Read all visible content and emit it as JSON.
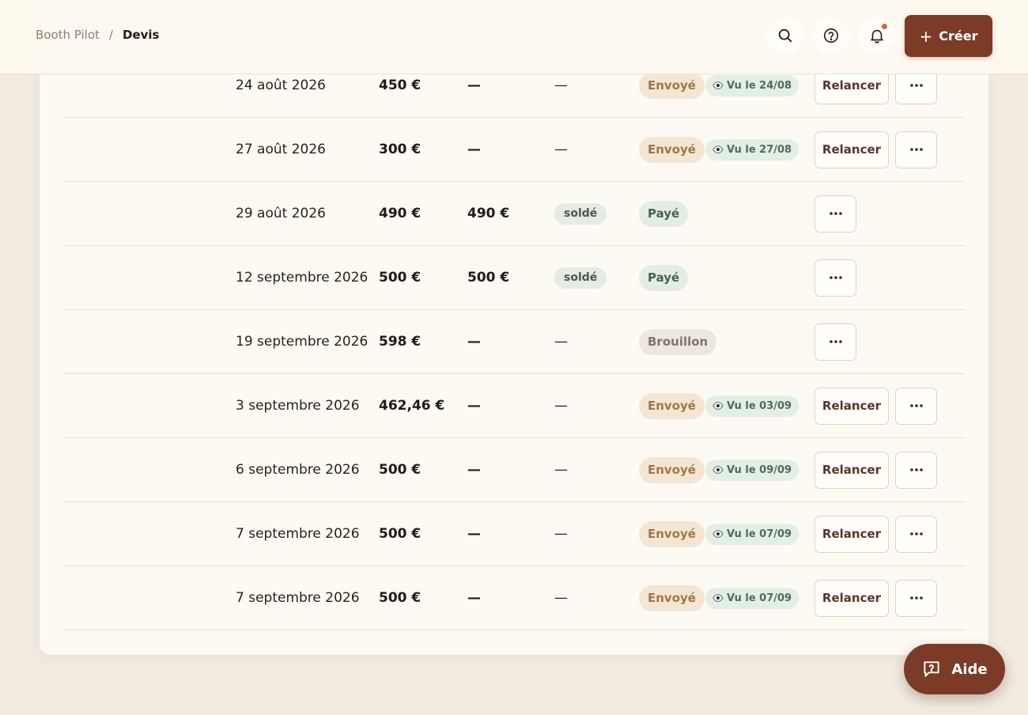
{
  "header": {
    "breadcrumb_parent": "Booth Pilot",
    "breadcrumb_separator": "/",
    "breadcrumb_current": "Devis",
    "create_label": "Créer",
    "create_icon": "plus-icon",
    "icons": [
      "search-icon",
      "help-icon",
      "bell-icon"
    ]
  },
  "help_button": {
    "label": "Aide",
    "icon": "chat-icon"
  },
  "rows": [
    {
      "date": "24 août 2026",
      "amount": "450 €",
      "paid": "—",
      "balance": "—",
      "status": "Envoyé",
      "seen": "Vu le 24/08",
      "action": "Relancer"
    },
    {
      "date": "27 août 2026",
      "amount": "300 €",
      "paid": "—",
      "balance": "—",
      "status": "Envoyé",
      "seen": "Vu le 27/08",
      "action": "Relancer"
    },
    {
      "date": "29 août 2026",
      "amount": "490 €",
      "paid": "490 €",
      "balance": "soldé",
      "status": "Payé",
      "seen": "",
      "action": ""
    },
    {
      "date": "12 septembre 2026",
      "amount": "500 €",
      "paid": "500 €",
      "balance": "soldé",
      "status": "Payé",
      "seen": "",
      "action": ""
    },
    {
      "date": "19 septembre 2026",
      "amount": "598 €",
      "paid": "—",
      "balance": "—",
      "status": "Brouillon",
      "seen": "",
      "action": ""
    },
    {
      "date": "3 septembre 2026",
      "amount": "462,46 €",
      "paid": "—",
      "balance": "—",
      "status": "Envoyé",
      "seen": "Vu le 03/09",
      "action": "Relancer"
    },
    {
      "date": "6 septembre 2026",
      "amount": "500 €",
      "paid": "—",
      "balance": "—",
      "status": "Envoyé",
      "seen": "Vu le 09/09",
      "action": "Relancer"
    },
    {
      "date": "7 septembre 2026",
      "amount": "500 €",
      "paid": "—",
      "balance": "—",
      "status": "Envoyé",
      "seen": "Vu le 07/09",
      "action": "Relancer"
    },
    {
      "date": "7 septembre 2026",
      "amount": "500 €",
      "paid": "—",
      "balance": "—",
      "status": "Envoyé",
      "seen": "Vu le 07/09",
      "action": "Relancer"
    }
  ],
  "colors": {
    "brand": "#7b3b26",
    "envoye_bg": "#f3e6d3",
    "paye_bg": "#e4ece3",
    "notification_dot": "#d2643f"
  }
}
